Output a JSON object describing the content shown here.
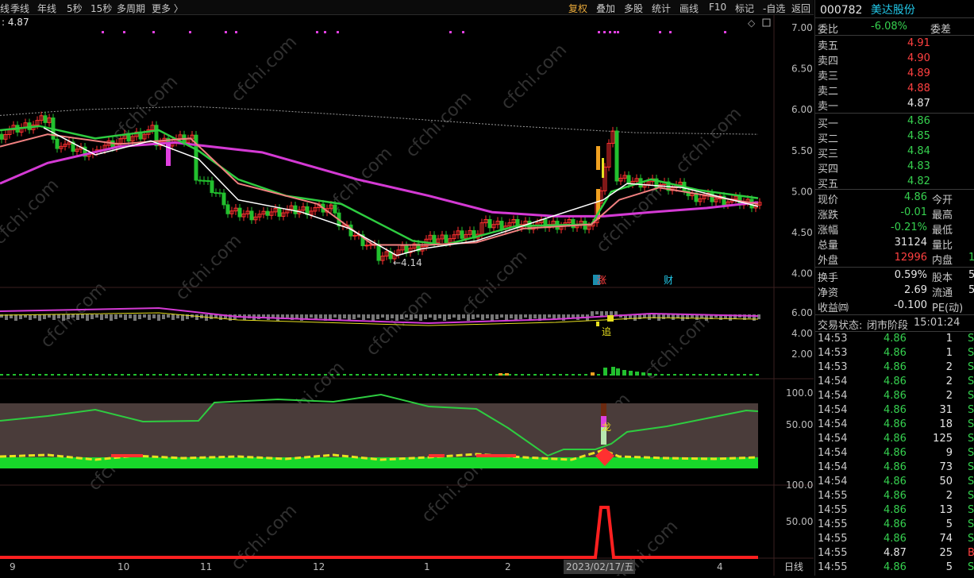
{
  "toolbar": {
    "left_items": [
      "线",
      "季线",
      "年线",
      "5秒",
      "15秒",
      "多周期",
      "更多 〉"
    ],
    "right_items": [
      "复权",
      "叠加",
      "多股",
      "统计",
      "画线",
      "F10",
      "标记",
      "-自选",
      "返回"
    ]
  },
  "chart": {
    "price_label": ": 4.87",
    "y_labels": [
      "7.00",
      "6.50",
      "6.00",
      "5.50",
      "5.00",
      "4.50",
      "4.00"
    ],
    "low_marker": "←4.14",
    "event_tags": [
      "涨",
      "财"
    ],
    "sub1_y_labels": [
      "6.00",
      "4.00",
      "2.00"
    ],
    "sub1_marker": "追",
    "sub2_y_labels": [
      "100.0",
      "50.00"
    ],
    "sub2_marker": "龙",
    "sub3_y_labels": [
      "100.0",
      "50.00"
    ],
    "x_labels": [
      "9",
      "10",
      "11",
      "12",
      "1",
      "2",
      "2023/02/17/五",
      "4"
    ],
    "period": "日线",
    "watermark": "cfchi.com",
    "colors": {
      "up": "#ff3030",
      "down": "#22c02e",
      "ma_magenta": "#d43ad4",
      "ma_green": "#2ecc40",
      "ma_white": "#ffffff",
      "ma_pink": "#f08080",
      "accent": "#e8a93a"
    }
  },
  "quote": {
    "code": "000782",
    "name": "美达股份",
    "weibi_label": "委比",
    "weibi_value": "-6.08%",
    "weicha_label": "委差",
    "asks": [
      {
        "label": "卖五",
        "price": "4.91"
      },
      {
        "label": "卖四",
        "price": "4.90"
      },
      {
        "label": "卖三",
        "price": "4.89"
      },
      {
        "label": "卖二",
        "price": "4.88"
      },
      {
        "label": "卖一",
        "price": "4.87"
      }
    ],
    "bids": [
      {
        "label": "买一",
        "price": "4.86"
      },
      {
        "label": "买二",
        "price": "4.85"
      },
      {
        "label": "买三",
        "price": "4.84"
      },
      {
        "label": "买四",
        "price": "4.83"
      },
      {
        "label": "买五",
        "price": "4.82"
      }
    ],
    "stats": [
      {
        "l1": "现价",
        "v1": "4.86",
        "l2": "今开",
        "c": "green"
      },
      {
        "l1": "涨跌",
        "v1": "-0.01",
        "l2": "最高",
        "c": "green"
      },
      {
        "l1": "涨幅",
        "v1": "-0.21%",
        "l2": "最低",
        "c": "green"
      },
      {
        "l1": "总量",
        "v1": "31124",
        "l2": "量比",
        "c": "white"
      },
      {
        "l1": "外盘",
        "v1": "12996",
        "l2": "内盘",
        "c": "red",
        "extra": "1"
      }
    ],
    "stats2": [
      {
        "l1": "换手",
        "v1": "0.59%",
        "l2": "股本",
        "extra": "5"
      },
      {
        "l1": "净资",
        "v1": "2.69",
        "l2": "流通",
        "extra": "5"
      },
      {
        "l1": "收益㈣",
        "v1": "-0.100",
        "l2": "PE(动)",
        "extra": ""
      }
    ],
    "trade_status_label": "交易状态:",
    "trade_status": "闭市阶段",
    "trade_time": "15:01:24",
    "ticks": [
      {
        "t": "14:53",
        "p": "4.86",
        "v": "1",
        "f": "S"
      },
      {
        "t": "14:53",
        "p": "4.86",
        "v": "1",
        "f": "S"
      },
      {
        "t": "14:53",
        "p": "4.86",
        "v": "2",
        "f": "S"
      },
      {
        "t": "14:54",
        "p": "4.86",
        "v": "2",
        "f": "S"
      },
      {
        "t": "14:54",
        "p": "4.86",
        "v": "2",
        "f": "S"
      },
      {
        "t": "14:54",
        "p": "4.86",
        "v": "31",
        "f": "S"
      },
      {
        "t": "14:54",
        "p": "4.86",
        "v": "18",
        "f": "S"
      },
      {
        "t": "14:54",
        "p": "4.86",
        "v": "125",
        "f": "S"
      },
      {
        "t": "14:54",
        "p": "4.86",
        "v": "9",
        "f": "S"
      },
      {
        "t": "14:54",
        "p": "4.86",
        "v": "73",
        "f": "S"
      },
      {
        "t": "14:54",
        "p": "4.86",
        "v": "50",
        "f": "S"
      },
      {
        "t": "14:55",
        "p": "4.86",
        "v": "2",
        "f": "S"
      },
      {
        "t": "14:55",
        "p": "4.86",
        "v": "13",
        "f": "S"
      },
      {
        "t": "14:55",
        "p": "4.86",
        "v": "5",
        "f": "S"
      },
      {
        "t": "14:55",
        "p": "4.86",
        "v": "74",
        "f": "S"
      },
      {
        "t": "14:55",
        "p": "4.87",
        "v": "25",
        "f": "B"
      },
      {
        "t": "14:55",
        "p": "4.86",
        "v": "5",
        "f": "S"
      }
    ]
  }
}
